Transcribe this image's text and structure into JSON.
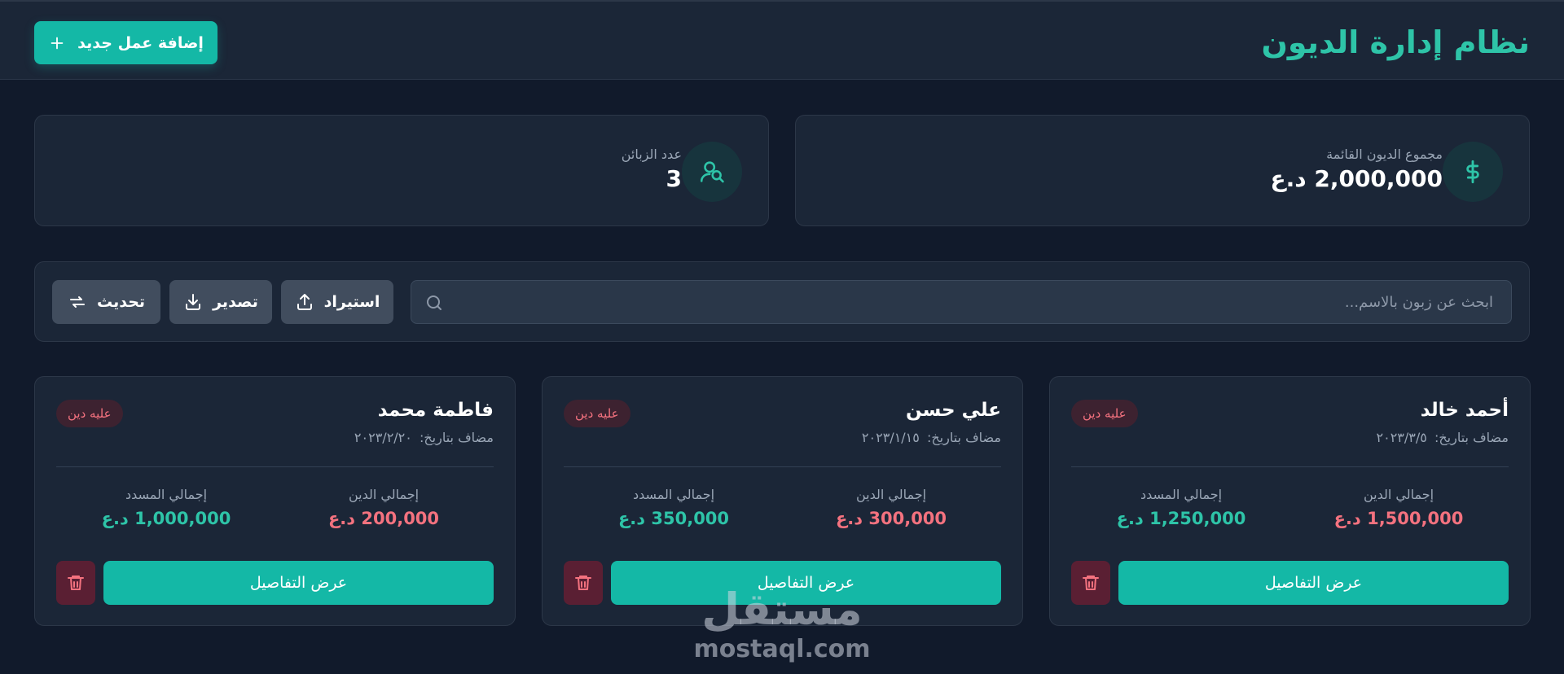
{
  "header": {
    "title": "نظام إدارة الديون",
    "add_button_label": "إضافة عمل جديد"
  },
  "stats": {
    "total_debts": {
      "label": "مجموع الديون القائمة",
      "value": "2,000,000 د.ع",
      "icon": "dollar-sign-icon"
    },
    "clients_count": {
      "label": "عدد الزبائن",
      "value": "3",
      "icon": "users-icon"
    }
  },
  "toolbar": {
    "search_placeholder": "ابحث عن زبون بالاسم...",
    "import_label": "استيراد",
    "export_label": "تصدير",
    "refresh_label": "تحديث"
  },
  "clients": [
    {
      "name": "أحمد خالد",
      "date_prefix": "مضاف بتاريخ:",
      "date": "٢٠٢٣/٣/٥",
      "badge": "عليه دين",
      "debt_label": "إجمالي الدين",
      "debt_value": "1,500,000 د.ع",
      "paid_label": "إجمالي المسدد",
      "paid_value": "1,250,000 د.ع",
      "details_label": "عرض التفاصيل"
    },
    {
      "name": "علي حسن",
      "date_prefix": "مضاف بتاريخ:",
      "date": "٢٠٢٣/١/١٥",
      "badge": "عليه دين",
      "debt_label": "إجمالي الدين",
      "debt_value": "300,000 د.ع",
      "paid_label": "إجمالي المسدد",
      "paid_value": "350,000 د.ع",
      "details_label": "عرض التفاصيل"
    },
    {
      "name": "فاطمة محمد",
      "date_prefix": "مضاف بتاريخ:",
      "date": "٢٠٢٣/٢/٢٠",
      "badge": "عليه دين",
      "debt_label": "إجمالي الدين",
      "debt_value": "200,000 د.ع",
      "paid_label": "إجمالي المسدد",
      "paid_value": "1,000,000 د.ع",
      "details_label": "عرض التفاصيل"
    }
  ],
  "watermark": {
    "logo": "مستقل",
    "url": "mostaql.com"
  },
  "colors": {
    "background": "#111a2b",
    "panel": "#1b2637",
    "accent": "#14b8a6",
    "debt": "#f4727f",
    "paid": "#2ec4a8",
    "delete": "#5a1f33"
  }
}
